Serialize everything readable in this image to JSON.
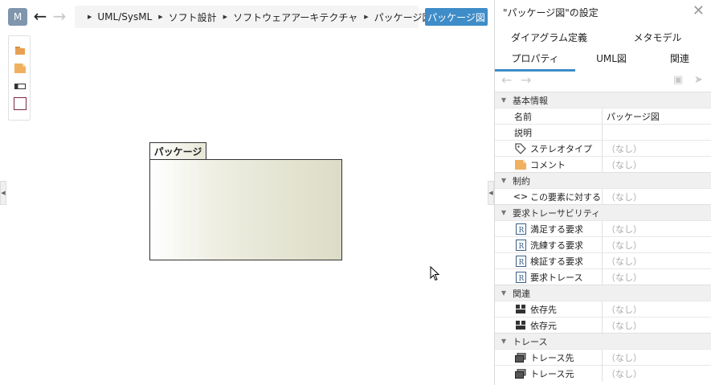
{
  "header": {
    "app_badge": "M",
    "breadcrumb": [
      "UML/SysML",
      "ソフト設計",
      "ソフトウェアアーキテクチャ",
      "パッケージ図"
    ],
    "diagram_button": "パッケージ図"
  },
  "diagram": {
    "package_label": "パッケージ"
  },
  "panel": {
    "title": "\"パッケージ図\"の設定",
    "tabs_row1": [
      "ダイアグラム定義",
      "メタモデル"
    ],
    "tabs_row2": [
      "プロパティ",
      "UML図",
      "関連"
    ],
    "active_tab": "プロパティ",
    "sections": [
      {
        "title": "基本情報",
        "rows": [
          {
            "name": "名前",
            "value": "パッケージ図"
          },
          {
            "name": "説明",
            "value": ""
          },
          {
            "name": "ステレオタイプ",
            "value": "（なし）",
            "icon": "tag-icon"
          },
          {
            "name": "コメント",
            "value": "（なし）",
            "icon": "comment-icon"
          }
        ]
      },
      {
        "title": "制約",
        "rows": [
          {
            "name": "この要素に対する…",
            "value": "（なし）",
            "icon": "code-icon"
          }
        ]
      },
      {
        "title": "要求トレーサビリティ",
        "rows": [
          {
            "name": "満足する要求",
            "value": "（なし）",
            "icon": "requirement-icon"
          },
          {
            "name": "洗練する要求",
            "value": "（なし）",
            "icon": "requirement-icon"
          },
          {
            "name": "検証する要求",
            "value": "（なし）",
            "icon": "requirement-icon"
          },
          {
            "name": "要求トレース",
            "value": "（なし）",
            "icon": "requirement-icon"
          }
        ]
      },
      {
        "title": "関連",
        "rows": [
          {
            "name": "依存先",
            "value": "（なし）",
            "icon": "dependency-icon"
          },
          {
            "name": "依存元",
            "value": "（なし）",
            "icon": "dependency-icon"
          }
        ]
      },
      {
        "title": "トレース",
        "rows": [
          {
            "name": "トレース先",
            "value": "（なし）",
            "icon": "trace-icon"
          },
          {
            "name": "トレース元",
            "value": "（なし）",
            "icon": "trace-icon"
          }
        ]
      }
    ]
  },
  "colors": {
    "accent": "#3e8cc8",
    "badge": "#7f96ad"
  }
}
